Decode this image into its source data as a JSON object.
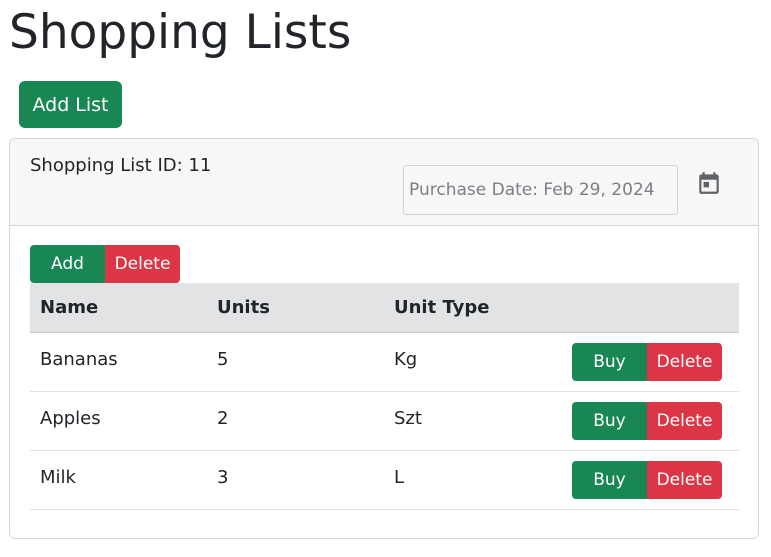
{
  "page": {
    "title": "Shopping Lists",
    "add_list_label": "Add List"
  },
  "list": {
    "id_text": "Shopping List ID: 11",
    "purchase_date_placeholder": "Purchase Date: Feb 29, 2024",
    "calendar_icon": "calendar-icon",
    "add_label": "Add",
    "delete_label": "Delete"
  },
  "table": {
    "headers": [
      "Name",
      "Units",
      "Unit Type"
    ],
    "rows": [
      {
        "name": "Bananas",
        "units": "5",
        "unit_type": "Kg",
        "buy_label": "Buy",
        "delete_label": "Delete"
      },
      {
        "name": "Apples",
        "units": "2",
        "unit_type": "Szt",
        "buy_label": "Buy",
        "delete_label": "Delete"
      },
      {
        "name": "Milk",
        "units": "3",
        "unit_type": "L",
        "buy_label": "Buy",
        "delete_label": "Delete"
      }
    ]
  },
  "colors": {
    "primary_green": "#198754",
    "danger_red": "#dc3545",
    "header_bg": "#e2e3e5",
    "card_header_bg": "#f7f7f7"
  }
}
